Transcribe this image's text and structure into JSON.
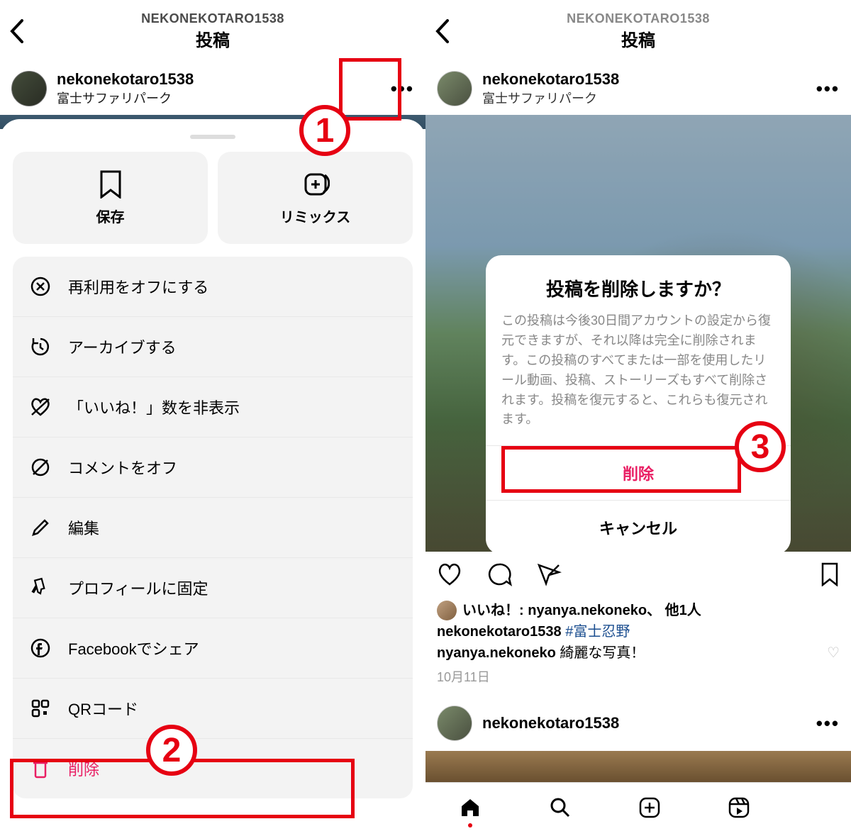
{
  "left": {
    "topbar": {
      "user": "NEKONEKOTARO1538",
      "title": "投稿"
    },
    "post": {
      "username": "nekonekotaro1538",
      "location": "富士サファリパーク",
      "more": "•••"
    },
    "sheet": {
      "top": [
        {
          "key": "save",
          "label": "保存"
        },
        {
          "key": "remix",
          "label": "リミックス"
        }
      ],
      "items": [
        {
          "key": "reuse-off",
          "label": "再利用をオフにする"
        },
        {
          "key": "archive",
          "label": "アーカイブする"
        },
        {
          "key": "hide-likes",
          "label": "「いいね！」数を非表示"
        },
        {
          "key": "comments-off",
          "label": "コメントをオフ"
        },
        {
          "key": "edit",
          "label": "編集"
        },
        {
          "key": "pin-profile",
          "label": "プロフィールに固定"
        },
        {
          "key": "share-facebook",
          "label": "Facebookでシェア"
        },
        {
          "key": "qr-code",
          "label": "QRコード"
        },
        {
          "key": "delete",
          "label": "削除",
          "danger": true
        }
      ]
    },
    "badges": {
      "b1": "1",
      "b2": "2"
    }
  },
  "right": {
    "topbar": {
      "user": "NEKONEKOTARO1538",
      "title": "投稿"
    },
    "post": {
      "username": "nekonekotaro1538",
      "location": "富士サファリパーク",
      "more": "•••"
    },
    "likes": {
      "prefix": "いいね！:",
      "names": "nyanya.nekoneko、",
      "suffix": "他1人"
    },
    "caption": {
      "user": "nekonekotaro1538",
      "hashtag": "#富士忍野"
    },
    "comment": {
      "user": "nyanya.nekoneko",
      "text": "綺麗な写真！"
    },
    "date": "10月11日",
    "next_user": "nekonekotaro1538",
    "dialog": {
      "title": "投稿を削除しますか？",
      "message": "この投稿は今後30日間アカウントの設定から復元できますが、それ以降は完全に削除されます。この投稿のすべてまたは一部を使用したリール動画、投稿、ストーリーズもすべて削除されます。投稿を復元すると、これらも復元されます。",
      "delete": "削除",
      "cancel": "キャンセル"
    },
    "badges": {
      "b3": "3"
    }
  }
}
